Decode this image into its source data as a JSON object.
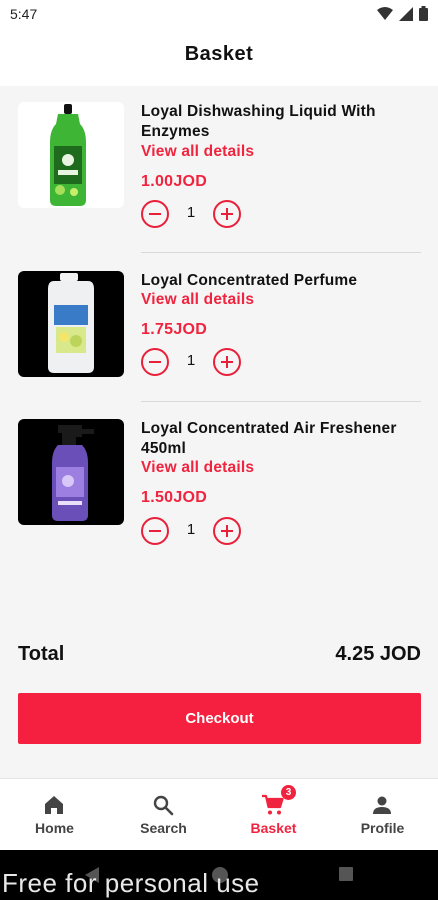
{
  "status_bar": {
    "time": "5:47"
  },
  "header": {
    "title": "Basket"
  },
  "basket": {
    "view_details_label": "View all details",
    "items": [
      {
        "name": "Loyal Dishwashing Liquid With Enzymes",
        "price": "1.00JOD",
        "quantity": "1"
      },
      {
        "name": "Loyal Concentrated Perfume",
        "price": "1.75JOD",
        "quantity": "1"
      },
      {
        "name": "Loyal Concentrated Air Freshener 450ml",
        "price": "1.50JOD",
        "quantity": "1"
      }
    ]
  },
  "summary": {
    "total_label": "Total",
    "total_value": "4.25 JOD",
    "checkout_label": "Checkout"
  },
  "bottom_nav": {
    "items": [
      {
        "label": "Home",
        "icon": "home-icon"
      },
      {
        "label": "Search",
        "icon": "search-icon"
      },
      {
        "label": "Basket",
        "icon": "cart-icon",
        "badge": "3",
        "active": true
      },
      {
        "label": "Profile",
        "icon": "person-icon"
      }
    ]
  },
  "watermark": "Free for personal use",
  "colors": {
    "accent": "#f0243f",
    "background": "#f5f5f5"
  }
}
